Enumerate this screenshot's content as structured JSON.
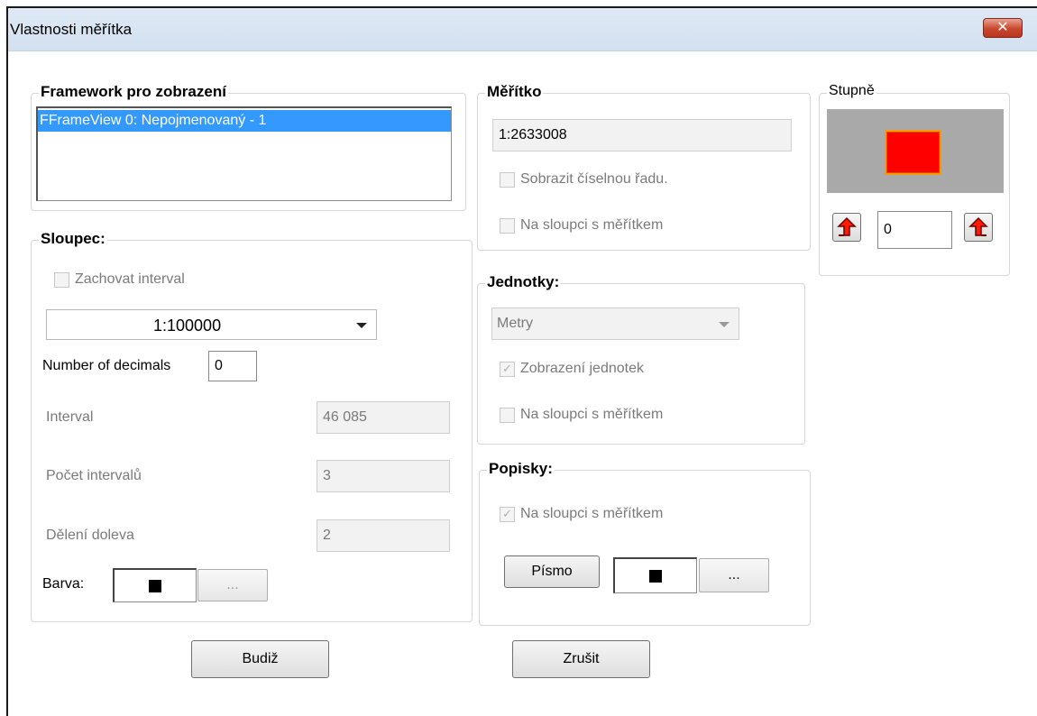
{
  "window": {
    "title": "Vlastnosti měřítka",
    "close_symbol": "✕"
  },
  "framework": {
    "title": "Framework pro zobrazení",
    "items": [
      "FFrameView 0: Nepojmenovaný - 1"
    ]
  },
  "sloupec": {
    "title": "Sloupec:",
    "keep_interval_label": "Zachovat interval",
    "scale_select_value": "1:100000",
    "decimals_label": "Number of decimals",
    "decimals_value": "0",
    "interval_label": "Interval",
    "interval_value": "46 085",
    "count_label": "Počet intervalů",
    "count_value": "3",
    "left_div_label": "Dělení doleva",
    "left_div_value": "2",
    "color_label": "Barva:",
    "color_button_label": "..."
  },
  "meritko": {
    "title": "Měřítko",
    "value": "1:2633008",
    "show_series_label": "Sobrazit číselnou řadu.",
    "on_bar_label": "Na sloupci s měřítkem"
  },
  "jednotky": {
    "title": "Jednotky:",
    "unit_value": "Metry",
    "show_units_label": "Zobrazení jednotek",
    "show_units_checkmark": "✓",
    "on_bar_label": "Na sloupci s měřítkem"
  },
  "popisky": {
    "title": "Popisky:",
    "on_bar_label": "Na sloupci s měřítkem",
    "on_bar_checkmark": "✓",
    "font_button_label": "Písmo",
    "color_button_label": "..."
  },
  "stupne": {
    "title": "Stupně",
    "value": "0",
    "preview_color": "#ff0000",
    "preview_border": "#ff9900",
    "preview_bg": "#a9a9a9"
  },
  "buttons": {
    "ok_label": "Budiž",
    "cancel_label": "Zrušit"
  }
}
